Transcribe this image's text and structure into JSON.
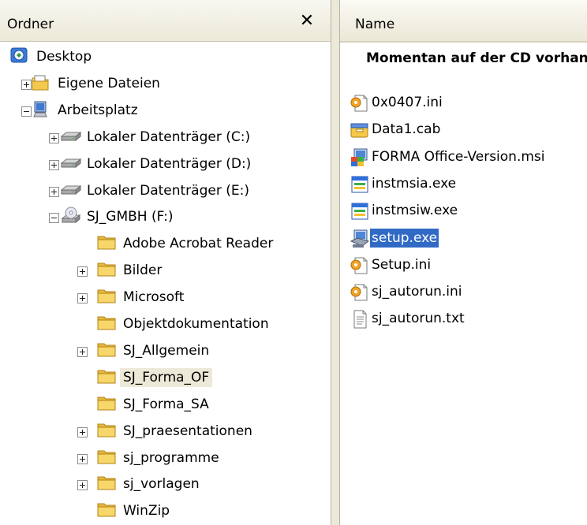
{
  "folder_pane": {
    "title": "Ordner",
    "close_glyph": "✕",
    "tree": [
      {
        "label": "Desktop",
        "icon": "desktop-icon",
        "level": 0,
        "expander": "none"
      },
      {
        "label": "Eigene Dateien",
        "icon": "my-documents-icon",
        "level": 1,
        "expander": "plus"
      },
      {
        "label": "Arbeitsplatz",
        "icon": "my-computer-icon",
        "level": 1,
        "expander": "minus"
      },
      {
        "label": "Lokaler Datenträger (C:)",
        "icon": "hard-drive-icon",
        "level": 2,
        "expander": "plus"
      },
      {
        "label": "Lokaler Datenträger (D:)",
        "icon": "hard-drive-icon",
        "level": 2,
        "expander": "plus"
      },
      {
        "label": "Lokaler Datenträger (E:)",
        "icon": "hard-drive-icon",
        "level": 2,
        "expander": "plus"
      },
      {
        "label": "SJ_GMBH (F:)",
        "icon": "cd-drive-icon",
        "level": 2,
        "expander": "minus"
      },
      {
        "label": "Adobe Acrobat Reader",
        "icon": "folder-icon",
        "level": 3,
        "expander": "none"
      },
      {
        "label": "Bilder",
        "icon": "folder-icon",
        "level": 3,
        "expander": "plus"
      },
      {
        "label": "Microsoft",
        "icon": "folder-icon",
        "level": 3,
        "expander": "plus"
      },
      {
        "label": "Objektdokumentation",
        "icon": "folder-icon",
        "level": 3,
        "expander": "none"
      },
      {
        "label": "SJ_Allgemein",
        "icon": "folder-icon",
        "level": 3,
        "expander": "plus"
      },
      {
        "label": "SJ_Forma_OF",
        "icon": "folder-icon",
        "level": 3,
        "expander": "none",
        "selected": true
      },
      {
        "label": "SJ_Forma_SA",
        "icon": "folder-icon",
        "level": 3,
        "expander": "none"
      },
      {
        "label": "SJ_praesentationen",
        "icon": "folder-icon",
        "level": 3,
        "expander": "plus"
      },
      {
        "label": "sj_programme",
        "icon": "folder-icon",
        "level": 3,
        "expander": "plus"
      },
      {
        "label": "sj_vorlagen",
        "icon": "folder-icon",
        "level": 3,
        "expander": "plus"
      },
      {
        "label": "WinZip",
        "icon": "folder-icon",
        "level": 3,
        "expander": "none"
      }
    ]
  },
  "file_pane": {
    "column_name": "Name",
    "group_header": "Momentan auf der CD vorhandene Dateien",
    "files": [
      {
        "name": "0x0407.ini",
        "icon": "ini-file-icon"
      },
      {
        "name": "Data1.cab",
        "icon": "cab-file-icon"
      },
      {
        "name": "FORMA Office-Version.msi",
        "icon": "msi-installer-icon"
      },
      {
        "name": "instmsia.exe",
        "icon": "exe-window-icon"
      },
      {
        "name": "instmsiw.exe",
        "icon": "exe-window-icon"
      },
      {
        "name": "setup.exe",
        "icon": "setup-exe-icon",
        "selected": true
      },
      {
        "name": "Setup.ini",
        "icon": "ini-file-icon"
      },
      {
        "name": "sj_autorun.ini",
        "icon": "ini-file-icon"
      },
      {
        "name": "sj_autorun.txt",
        "icon": "text-file-icon"
      }
    ]
  },
  "colors": {
    "selection": "#316ac5",
    "inactive_selection": "#ece9d8",
    "folder_yellow": "#f5cf5a"
  }
}
